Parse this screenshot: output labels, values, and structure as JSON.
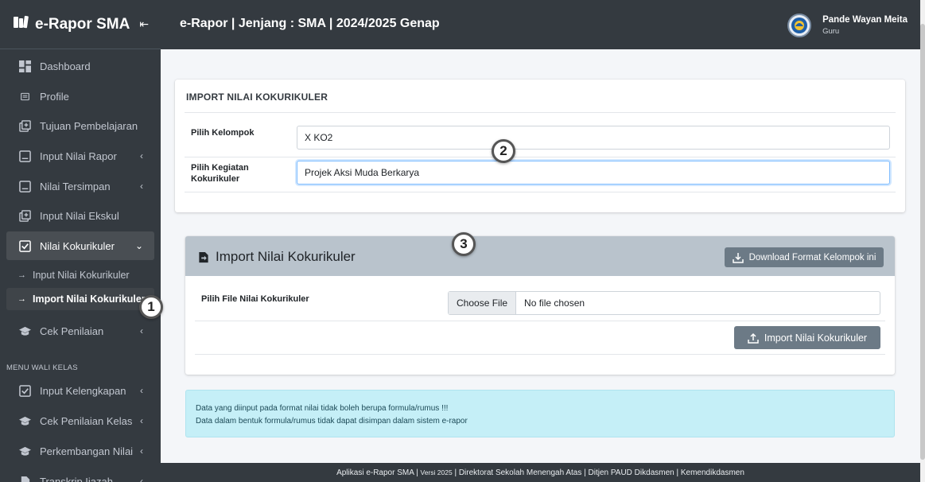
{
  "sidebar": {
    "brand": "e-Rapor SMA",
    "items": [
      {
        "label": "Dashboard",
        "icon": "dashboard-icon"
      },
      {
        "label": "Profile",
        "icon": "id-card-icon"
      },
      {
        "label": "Tujuan Pembelajaran",
        "icon": "plus-square-icon"
      },
      {
        "label": "Input Nilai Rapor",
        "icon": "square-icon"
      },
      {
        "label": "Nilai Tersimpan",
        "icon": "square-icon"
      },
      {
        "label": "Input Nilai Ekskul",
        "icon": "plus-square-icon"
      },
      {
        "label": "Nilai Kokurikuler",
        "icon": "check-square-icon"
      },
      {
        "label": "Input Nilai Kokurikuler"
      },
      {
        "label": "Import Nilai Kokurikuler"
      },
      {
        "label": "Cek Penilaian",
        "icon": "graduation-cap-icon"
      }
    ],
    "wali_header": "MENU WALI KELAS",
    "wali_items": [
      {
        "label": "Input Kelengkapan",
        "icon": "check-square-icon"
      },
      {
        "label": "Cek Penilaian Kelas",
        "icon": "graduation-cap-icon"
      },
      {
        "label": "Perkembangan Nilai",
        "icon": "graduation-cap-icon"
      },
      {
        "label": "Transkrip Ijazah",
        "icon": "file-icon"
      }
    ]
  },
  "header": {
    "title": "e-Rapor | Jenjang : SMA | 2024/2025 Genap",
    "user_name": "Pande Wayan Meita",
    "user_role": "Guru"
  },
  "form": {
    "title": "IMPORT NILAI KOKURIKULER",
    "kelompok_label": "Pilih Kelompok",
    "kelompok_value": "X KO2",
    "kegiatan_label": "Pilih Kegiatan Kokurikuler",
    "kegiatan_value": "Projek Aksi Muda Berkarya"
  },
  "import_card": {
    "title": "Import Nilai Kokurikuler",
    "download_label": "Download Format Kelompok ini",
    "file_label": "Pilih File Nilai Kokurikuler",
    "choose_file": "Choose File",
    "no_file": "No file chosen",
    "import_button": "Import Nilai Kokurikuler"
  },
  "alert": {
    "line1": "Data yang diinput pada format nilai tidak boleh berupa formula/rumus !!!",
    "line2": "Data dalam bentuk formula/rumus tidak dapat disimpan dalam sistem e-rapor"
  },
  "footer": {
    "app": "Aplikasi e-Rapor SMA",
    "version": "Versi 2025",
    "rest": "Direktorat Sekolah Menengah Atas | Ditjen PAUD Dikdasmen | Kemendikdasmen"
  },
  "markers": [
    "1",
    "2",
    "3"
  ],
  "colors": {
    "sidebar_bg": "#343a40",
    "content_bg": "#f4f6f9",
    "card_header_bg": "#b9c3cc",
    "button_gray": "#6c7a86",
    "alert_bg": "#c5eff7"
  }
}
